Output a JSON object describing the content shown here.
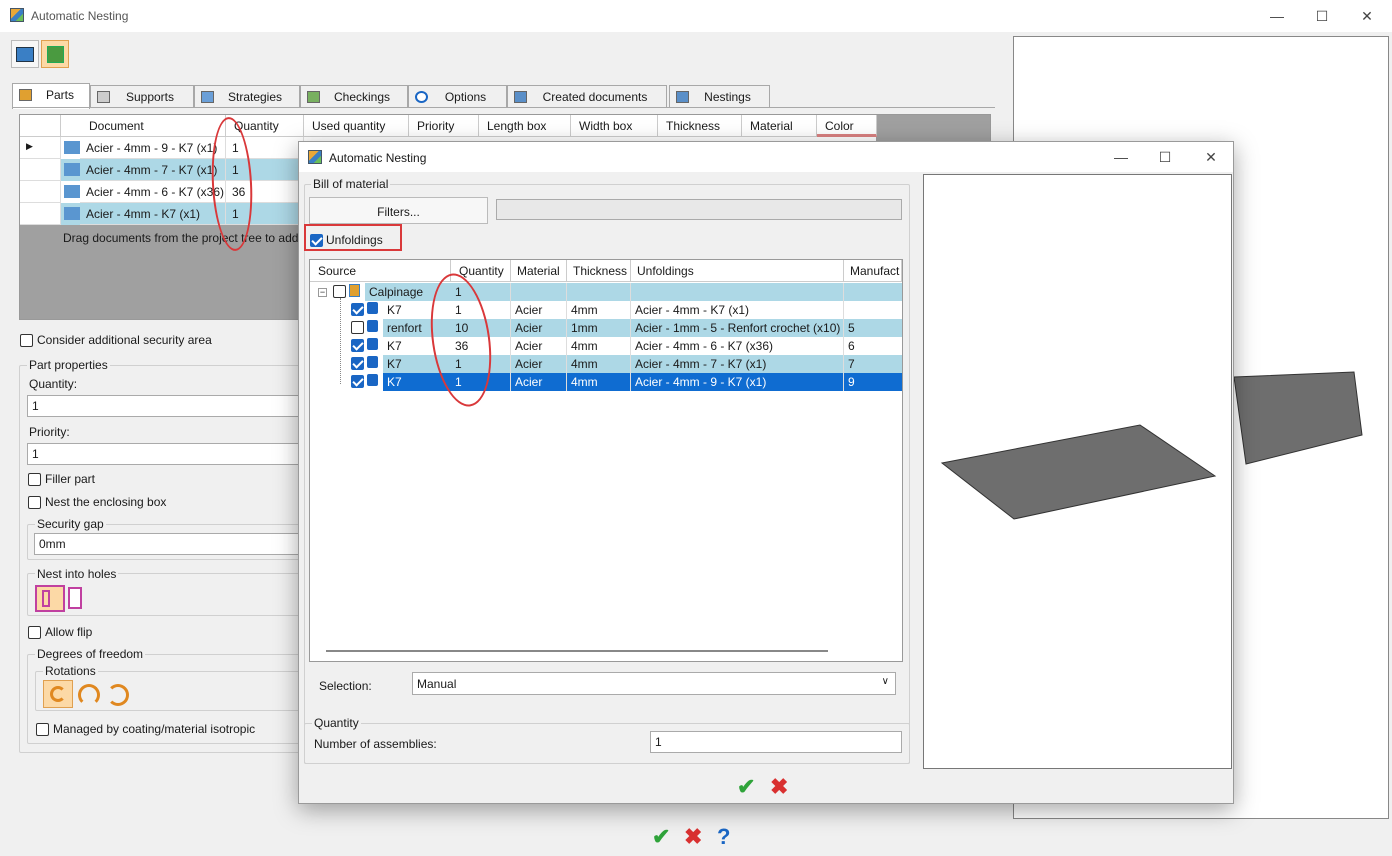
{
  "main_window": {
    "title": "Automatic Nesting",
    "controls": {
      "minimize": "—",
      "maximize": "☐",
      "close": "✕"
    }
  },
  "tabs": [
    {
      "label": "Parts",
      "icon": "parts-icon"
    },
    {
      "label": "Supports",
      "icon": "supports-icon"
    },
    {
      "label": "Strategies",
      "icon": "strategies-icon"
    },
    {
      "label": "Checkings",
      "icon": "checkings-icon"
    },
    {
      "label": "Options",
      "icon": "gear-icon"
    },
    {
      "label": "Created documents",
      "icon": "documents-icon"
    },
    {
      "label": "Nestings",
      "icon": "nestings-icon"
    }
  ],
  "parts_table": {
    "headers": [
      "Document",
      "Quantity",
      "Used quantity",
      "Priority",
      "Length box",
      "Width box",
      "Thickness",
      "Material",
      "Color"
    ],
    "rows": [
      {
        "document": "Acier - 4mm - 9 - K7 (x1)",
        "quantity": "1",
        "current": true
      },
      {
        "document": "Acier - 4mm - 7 - K7 (x1)",
        "quantity": "1"
      },
      {
        "document": "Acier - 4mm - 6 - K7 (x36)",
        "quantity": "36"
      },
      {
        "document": "Acier - 4mm - K7 (x1)",
        "quantity": "1"
      }
    ],
    "drag_hint": "Drag documents from the project tree to add"
  },
  "options": {
    "security_area_label": "Consider additional security area",
    "part_properties_title": "Part properties",
    "quantity_label": "Quantity:",
    "quantity_value": "1",
    "priority_label": "Priority:",
    "priority_value": "1",
    "filler_label": "Filler part",
    "enclosing_label": "Nest the enclosing box",
    "security_gap_title": "Security gap",
    "security_gap_value": "0mm",
    "nest_holes_title": "Nest into holes",
    "allow_flip_label": "Allow flip",
    "dof_title": "Degrees of freedom",
    "rotations_title": "Rotations",
    "isotropic_label": "Managed by coating/material isotropic"
  },
  "dialog": {
    "title": "Automatic Nesting",
    "bom_title": "Bill of material",
    "filters_label": "Filters...",
    "unfoldings_label": "Unfoldings",
    "unfoldings_checked": true,
    "bom_headers": [
      "Source",
      "Quantity",
      "Material",
      "Thickness",
      "Unfoldings",
      "Manufact"
    ],
    "bom_rows": [
      {
        "source": "Calpinage",
        "quantity": "1",
        "material": "",
        "thickness": "",
        "unfoldings": "",
        "manufact": "",
        "checked": false,
        "level": 0
      },
      {
        "source": "K7",
        "quantity": "1",
        "material": "Acier",
        "thickness": "4mm",
        "unfoldings": "Acier - 4mm - K7 (x1)",
        "manufact": "",
        "checked": true,
        "level": 1
      },
      {
        "source": "renfort",
        "quantity": "10",
        "material": "Acier",
        "thickness": "1mm",
        "unfoldings": "Acier - 1mm - 5 - Renfort crochet (x10)",
        "manufact": "5",
        "checked": false,
        "level": 1
      },
      {
        "source": "K7",
        "quantity": "36",
        "material": "Acier",
        "thickness": "4mm",
        "unfoldings": "Acier - 4mm - 6 - K7 (x36)",
        "manufact": "6",
        "checked": true,
        "level": 1
      },
      {
        "source": "K7",
        "quantity": "1",
        "material": "Acier",
        "thickness": "4mm",
        "unfoldings": "Acier - 4mm - 7 - K7 (x1)",
        "manufact": "7",
        "checked": true,
        "level": 1
      },
      {
        "source": "K7",
        "quantity": "1",
        "material": "Acier",
        "thickness": "4mm",
        "unfoldings": "Acier - 4mm - 9 - K7 (x1)",
        "manufact": "9",
        "checked": true,
        "level": 1
      }
    ],
    "selection_label": "Selection:",
    "selection_value": "Manual",
    "quantity_title": "Quantity",
    "assemblies_label": "Number of assemblies:",
    "assemblies_value": "1"
  },
  "colors": {
    "accent": "#0f6cd1",
    "row_highlight": "#add8e6",
    "annotation_red": "#d9383a",
    "ok_green": "#2fa33a"
  },
  "footer": {
    "ok": "✔",
    "cancel": "✖",
    "help": "?"
  }
}
